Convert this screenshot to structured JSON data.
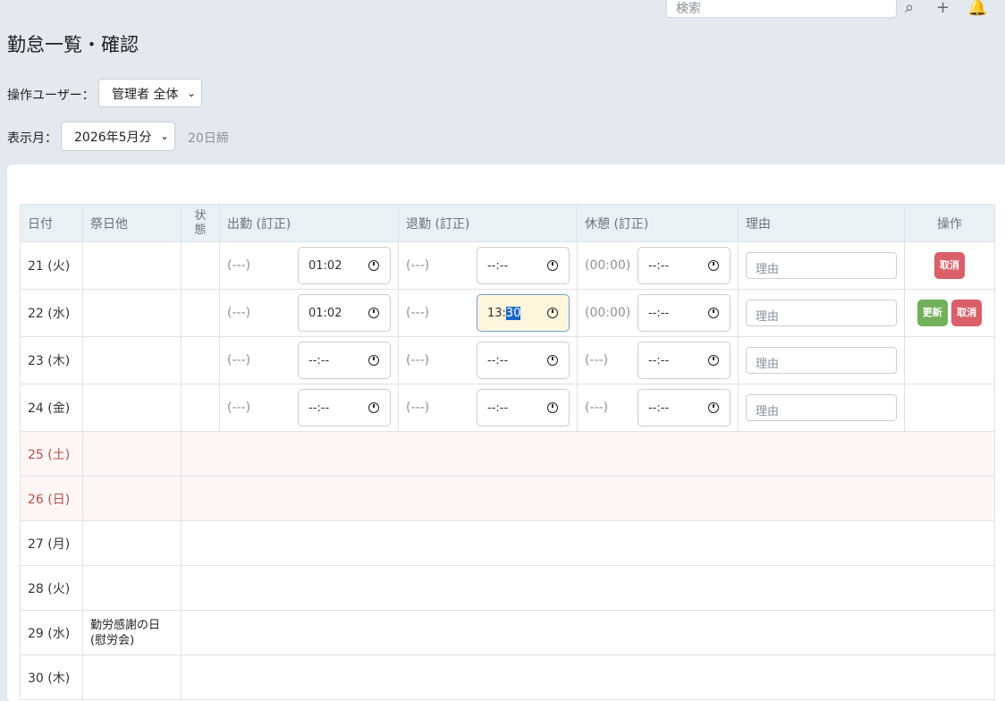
{
  "header": {
    "search_placeholder": "検索",
    "icons": [
      "search-icon",
      "plus-icon",
      "bell-icon",
      "more-icon"
    ]
  },
  "page_title": "勤怠一覧・確認",
  "operator": {
    "label": "操作ユーザー：",
    "value": "管理者 全体"
  },
  "month": {
    "label": "表示月：",
    "value": "2026年5月分",
    "closing_note": "20日締"
  },
  "table": {
    "headers": {
      "date": "日付",
      "holiday": "祭日他",
      "status": "状態",
      "clock_in": "出勤 (訂正)",
      "clock_out": "退勤 (訂正)",
      "break": "休憩 (訂正)",
      "reason": "理由",
      "ops": "操作"
    },
    "rows": [
      {
        "date": "21 (火)",
        "in_orig": "(---)",
        "in_val": "01:02",
        "out_orig": "(---)",
        "out_val": "--:--",
        "brk_orig": "(00:00)",
        "brk_val": "--:--",
        "reason_ph": "理由",
        "buttons": [
          "取消"
        ]
      },
      {
        "date": "22 (水)",
        "in_orig": "(---)",
        "in_val": "01:02",
        "out_orig": "(---)",
        "out_h": "13:",
        "out_m": "30",
        "brk_orig": "(00:00)",
        "brk_val": "--:--",
        "reason_ph": "理由",
        "buttons": [
          "更新",
          "取消"
        ]
      },
      {
        "date": "23 (木)",
        "in_orig": "(---)",
        "in_val": "--:--",
        "out_orig": "(---)",
        "out_val": "--:--",
        "brk_orig": "(---)",
        "brk_val": "--:--",
        "reason_ph": "理由"
      },
      {
        "date": "24 (金)",
        "in_orig": "(---)",
        "in_val": "--:--",
        "out_orig": "(---)",
        "out_val": "--:--",
        "brk_orig": "(---)",
        "brk_val": "--:--",
        "reason_ph": "理由"
      },
      {
        "date": "25 (土)",
        "weekend": true
      },
      {
        "date": "26 (日)",
        "weekend": true
      },
      {
        "date": "27 (月)"
      },
      {
        "date": "28 (火)"
      },
      {
        "date": "29 (水)",
        "holiday": "勤労感謝の日\n(慰労会)"
      },
      {
        "date": "30 (木)"
      }
    ]
  },
  "colors": {
    "weekend_text": "#b0514b",
    "update_button": "#72b05b",
    "cancel_button": "#d9606a",
    "active_input": "#fdf6dc"
  }
}
